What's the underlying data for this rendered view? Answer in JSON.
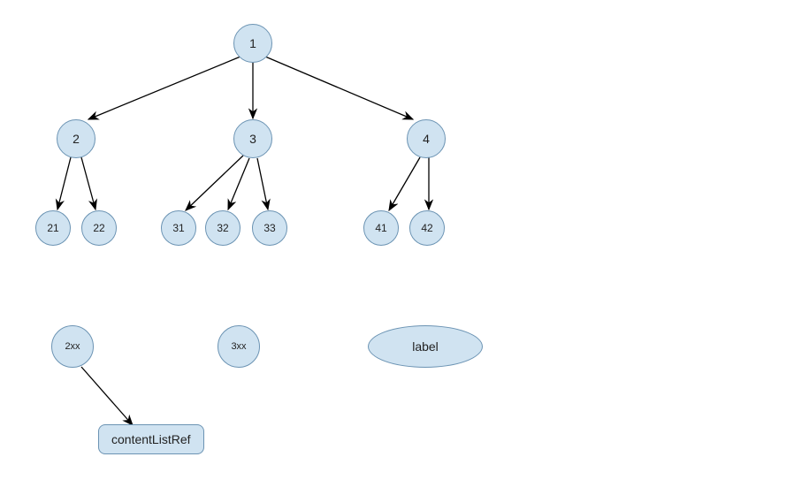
{
  "nodes": {
    "root": "1",
    "child2": "2",
    "child3": "3",
    "child4": "4",
    "n21": "21",
    "n22": "22",
    "n31": "31",
    "n32": "32",
    "n33": "33",
    "n41": "41",
    "n42": "42",
    "n2xx": "2xx",
    "n3xx": "3xx",
    "label": "label",
    "contentListRef": "contentListRef"
  }
}
